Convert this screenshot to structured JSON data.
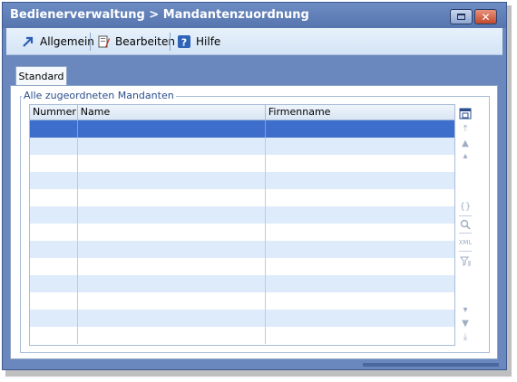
{
  "window": {
    "title": "Bedienerverwaltung > Mandantenzuordnung"
  },
  "toolbar": {
    "items": [
      {
        "label": "Allgemein",
        "icon": "arrow-up-right-icon"
      },
      {
        "label": "Bearbeiten",
        "icon": "edit-document-icon"
      },
      {
        "label": "Hilfe",
        "icon": "help-icon"
      }
    ]
  },
  "tabs": [
    {
      "label": "Standard",
      "active": true
    }
  ],
  "group": {
    "title": "Alle zugeordneten Mandanten"
  },
  "table": {
    "columns": [
      "Nummer",
      "Name",
      "Firmenname"
    ],
    "rows": 13,
    "selected_row": 0
  },
  "colors": {
    "title_bar": "#5f7fb8",
    "toolbar": "#dde9f7",
    "row_alt": "#ddebfa",
    "row_selected": "#3d6ecb",
    "legend_text": "#2a4f8c"
  }
}
